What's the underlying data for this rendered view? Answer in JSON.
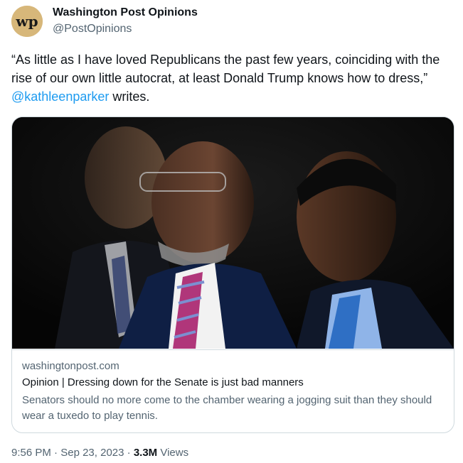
{
  "author": {
    "name": "Washington Post Opinions",
    "handle": "@PostOpinions",
    "avatar_icon": "wapo-logo-icon",
    "avatar_text": "wp"
  },
  "tweet": {
    "text_before": "“As little as I have loved Republicans the past few years, coinciding with the rise of our own little autocrat, at least Donald Trump knows how to dress,” ",
    "mention": "@kathleenparker",
    "text_after": " writes."
  },
  "card": {
    "domain": "washingtonpost.com",
    "title": "Opinion | Dressing down for the Senate is just bad manners",
    "description": "Senators should no more come to the chamber wearing a jogging suit than they should wear a tuxedo to play tennis."
  },
  "footer": {
    "time": "9:56 PM",
    "date": "Sep 23, 2023",
    "views_count": "3.3M",
    "views_label": "Views"
  },
  "colors": {
    "link": "#1d9bf0",
    "secondary_text": "#536471",
    "avatar_bg": "#d7b77a"
  }
}
